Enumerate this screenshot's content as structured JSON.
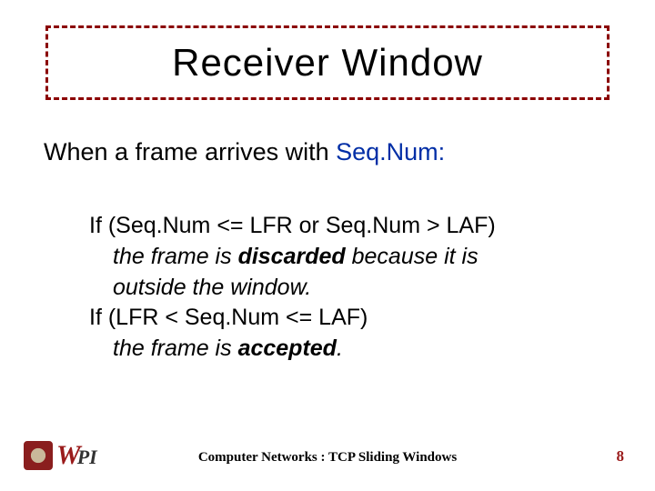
{
  "title": "Receiver Window",
  "intro": {
    "prefix": "When a frame arrives with ",
    "seqnum": "Seq.Num:"
  },
  "body": {
    "line1": "If  (Seq.Num <= LFR or Seq.Num > LAF)",
    "line2a": "the frame is ",
    "line2b": "discarded",
    "line2c": "  because it is",
    "line3": "outside the window.",
    "line4": "If  (LFR < Seq.Num <=  LAF)",
    "line5a": "the frame is ",
    "line5b": "accepted",
    "line5c": "."
  },
  "footer": {
    "logo_text_w": "W",
    "logo_text_pi": "PI",
    "title": "Computer Networks : TCP Sliding Windows",
    "page": "8"
  },
  "colors": {
    "accent": "#8b0000",
    "link_blue": "#002ea6",
    "wpi_red": "#9a1b1b"
  }
}
